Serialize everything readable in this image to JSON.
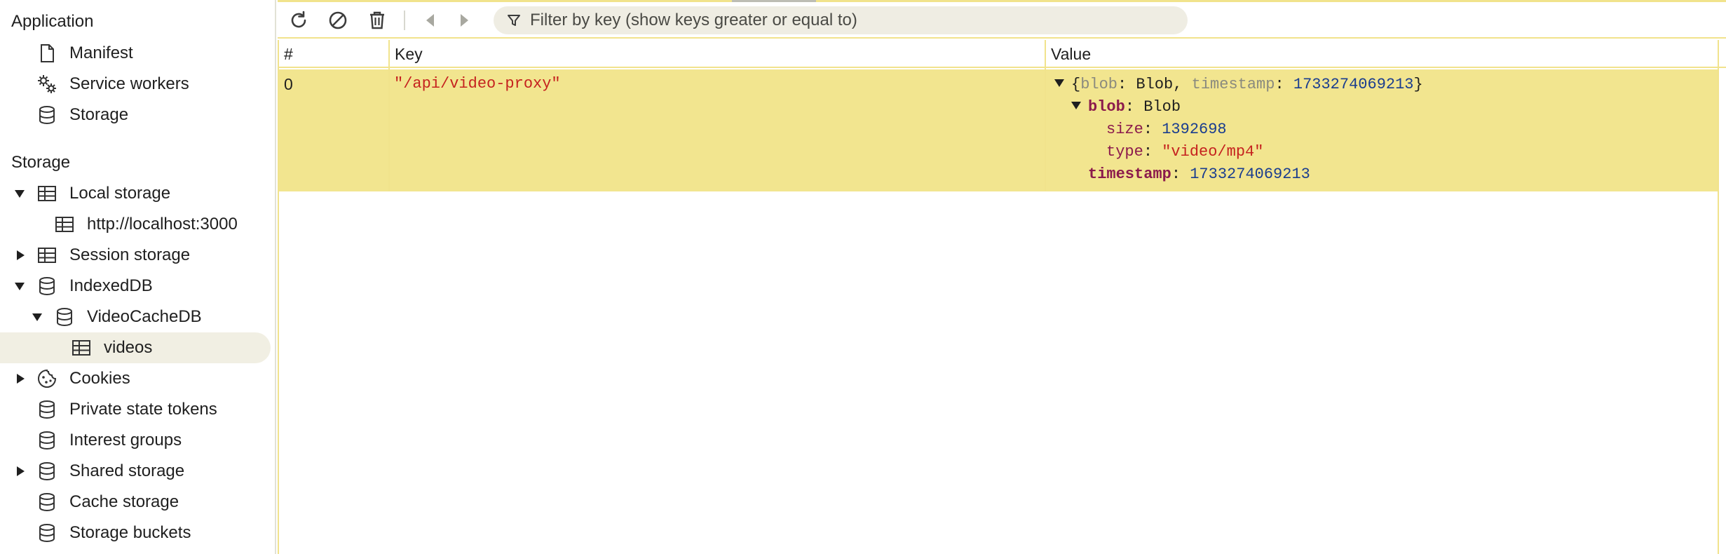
{
  "sidebar": {
    "application_header": "Application",
    "storage_header": "Storage",
    "application_items": [
      {
        "label": "Manifest",
        "icon": "document-icon"
      },
      {
        "label": "Service workers",
        "icon": "gears-icon"
      },
      {
        "label": "Storage",
        "icon": "database-icon"
      }
    ],
    "storage_items": [
      {
        "label": "Local storage",
        "icon": "table-icon",
        "expanded": true
      },
      {
        "label": "http://localhost:3000",
        "icon": "table-icon"
      },
      {
        "label": "Session storage",
        "icon": "table-icon",
        "expanded": false
      },
      {
        "label": "IndexedDB",
        "icon": "database-icon",
        "expanded": true
      },
      {
        "label": "VideoCacheDB",
        "icon": "database-icon",
        "expanded": true
      },
      {
        "label": "videos",
        "icon": "table-icon",
        "selected": true
      },
      {
        "label": "Cookies",
        "icon": "cookie-icon",
        "expanded": false
      },
      {
        "label": "Private state tokens",
        "icon": "database-icon"
      },
      {
        "label": "Interest groups",
        "icon": "database-icon"
      },
      {
        "label": "Shared storage",
        "icon": "database-icon",
        "expanded": false
      },
      {
        "label": "Cache storage",
        "icon": "database-icon"
      },
      {
        "label": "Storage buckets",
        "icon": "database-icon"
      }
    ]
  },
  "toolbar": {
    "refresh_icon": "refresh-icon",
    "clear_icon": "block-icon",
    "delete_icon": "trash-icon",
    "prev_icon": "triangle-left-icon",
    "next_icon": "triangle-right-icon",
    "filter_placeholder": "Filter by key (show keys greater or equal to)"
  },
  "table": {
    "headers": {
      "index": "#",
      "key": "Key",
      "value": "Value"
    },
    "rows": [
      {
        "index": "0",
        "key": "\"/api/video-proxy\"",
        "value": {
          "summary_open": "{",
          "summary_blob_key": "blob",
          "summary_blob_sep": ": Blob, ",
          "summary_ts_key": "timestamp",
          "summary_colon": ": ",
          "summary_ts_val": "1733274069213",
          "summary_close": "}",
          "blob_key": "blob",
          "blob_type": ": Blob",
          "size_key": "size",
          "size_val": "1392698",
          "type_key": "type",
          "type_val": "\"video/mp4\"",
          "timestamp_key": "timestamp",
          "timestamp_val": "1733274069213",
          "colon": ": "
        }
      }
    ]
  },
  "colors": {
    "selected_row": "#f2e58f",
    "accent_border": "#f1e38c",
    "string": "#c5221f",
    "number": "#1a3d8f",
    "property": "#8b1a4c"
  }
}
